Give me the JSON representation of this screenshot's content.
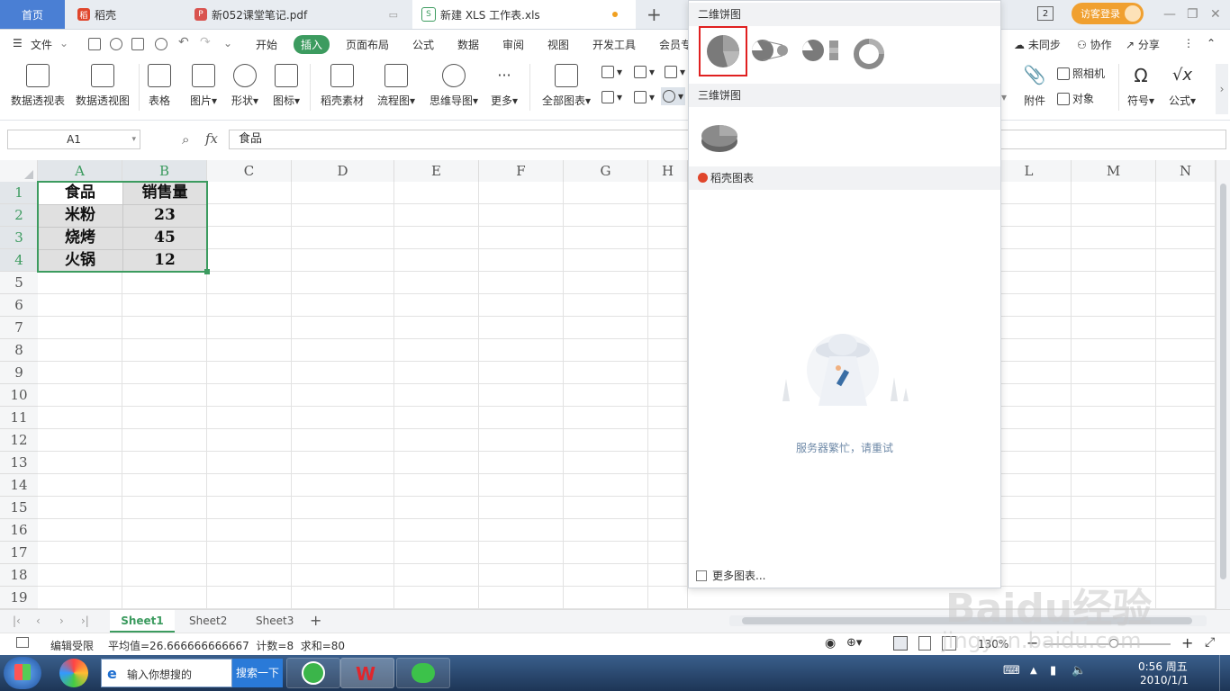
{
  "tabs": {
    "home": "首页",
    "daoke": "稻壳",
    "pdf": "新052课堂笔记.pdf",
    "xls": "新建 XLS 工作表.xls",
    "add": "+"
  },
  "titlebar": {
    "page_badge": "2",
    "visitor_login": "访客登录"
  },
  "menubar": {
    "file": "文件",
    "items": [
      "开始",
      "插入",
      "页面布局",
      "公式",
      "数据",
      "审阅",
      "视图",
      "开发工具",
      "会员专"
    ],
    "right": [
      "未同步",
      "协作",
      "分享"
    ]
  },
  "toolbar": {
    "buttons": [
      "数据透视表",
      "数据透视图",
      "表格",
      "图片",
      "形状",
      "图标",
      "稻壳素材",
      "流程图",
      "思维导图",
      "更多",
      "全部图表"
    ],
    "right": [
      "附件",
      "照相机",
      "对象",
      "符号",
      "公式"
    ]
  },
  "formula": {
    "cell_ref": "A1",
    "fx": "fx",
    "value": "食品"
  },
  "sheet": {
    "columns": [
      "A",
      "B",
      "C",
      "D",
      "E",
      "F",
      "G",
      "H",
      "L",
      "M",
      "N"
    ],
    "rows": [
      "1",
      "2",
      "3",
      "4",
      "5",
      "6",
      "7",
      "8",
      "9",
      "10",
      "11",
      "12",
      "13",
      "14",
      "15",
      "16",
      "17",
      "18",
      "19"
    ],
    "data": [
      [
        "食品",
        "销售量"
      ],
      [
        "米粉",
        "23"
      ],
      [
        "烧烤",
        "45"
      ],
      [
        "火锅",
        "12"
      ]
    ]
  },
  "chart_panel": {
    "section_2d": "二维饼图",
    "section_3d": "三维饼图",
    "section_daoke": "稻壳图表",
    "error_msg": "服务器繁忙，请重试",
    "more_charts": "更多图表..."
  },
  "sheets": [
    "Sheet1",
    "Sheet2",
    "Sheet3"
  ],
  "status": {
    "mode": "编辑受限",
    "stats": "平均值=26.666666666667  计数=8  求和=80",
    "zoom": "130%"
  },
  "taskbar": {
    "search_placeholder": "输入你想搜的",
    "search_btn": "搜索一下",
    "time": "0:56 周五",
    "date": "2010/1/1"
  },
  "watermark": {
    "text": "Baidu经验",
    "url": "jingyan.baidu.com"
  },
  "colors": {
    "accent": "#3c9b5f",
    "home_tab": "#4a7fd4",
    "visitor": "#f0a030",
    "highlight": "#e02020"
  }
}
